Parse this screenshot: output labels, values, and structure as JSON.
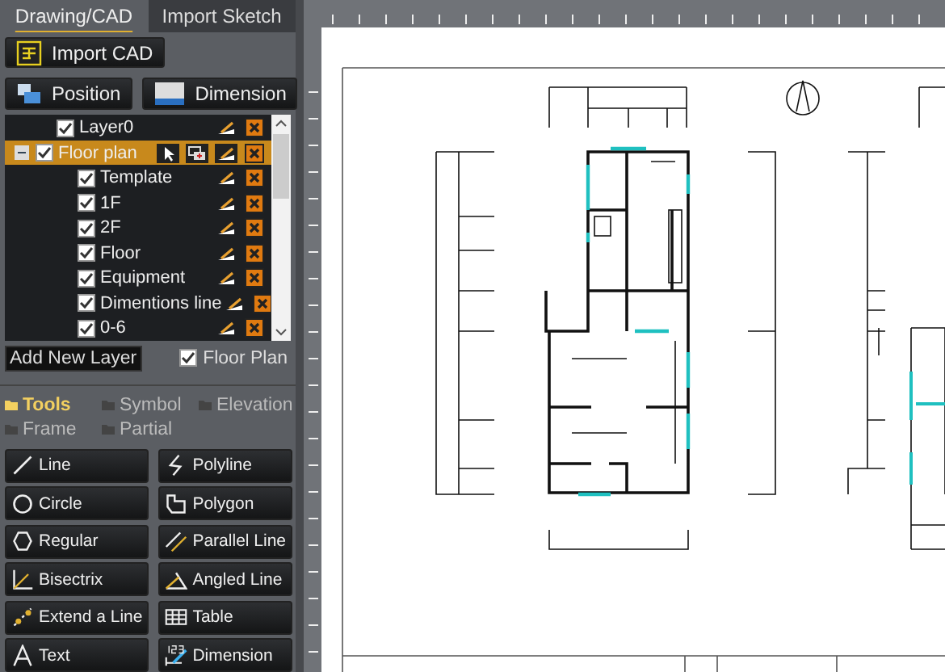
{
  "tabs": [
    {
      "label": "Drawing/CAD",
      "selected": true
    },
    {
      "label": "Import Sketch",
      "selected": false
    }
  ],
  "import_button": "Import CAD",
  "view_buttons": [
    "Position",
    "Dimension"
  ],
  "layers": [
    {
      "name": "Layer0",
      "checked": true,
      "selected": false
    },
    {
      "name": "Floor plan",
      "checked": true,
      "selected": true,
      "expanded": true,
      "children": [
        {
          "name": "Template",
          "checked": true,
          "selected": false
        },
        {
          "name": "1F",
          "checked": true,
          "selected": false
        },
        {
          "name": "2F",
          "checked": true,
          "selected": false
        },
        {
          "name": "Floor",
          "checked": true,
          "selected": false
        },
        {
          "name": "Equipment",
          "checked": true,
          "selected": false
        },
        {
          "name": "Dimentions line",
          "checked": true,
          "selected": false
        },
        {
          "name": "0-6",
          "checked": true,
          "selected": false
        }
      ]
    }
  ],
  "add_layer_button": "Add New Layer",
  "floor_plan_toggle": {
    "label": "Floor Plan",
    "checked": true
  },
  "categories": [
    {
      "label": "Tools",
      "selected": true
    },
    {
      "label": "Symbol",
      "selected": false
    },
    {
      "label": "Elevation",
      "selected": false
    },
    {
      "label": "Frame",
      "selected": false
    },
    {
      "label": "Partial",
      "selected": false
    }
  ],
  "tools": [
    {
      "label": "Line"
    },
    {
      "label": "Polyline"
    },
    {
      "label": "Circle"
    },
    {
      "label": "Polygon"
    },
    {
      "label": "Regular"
    },
    {
      "label": "Parallel Line"
    },
    {
      "label": "Bisectrix"
    },
    {
      "label": "Angled Line"
    },
    {
      "label": "Extend a Line"
    },
    {
      "label": "Table"
    },
    {
      "label": "Text"
    },
    {
      "label": "Dimension"
    }
  ]
}
